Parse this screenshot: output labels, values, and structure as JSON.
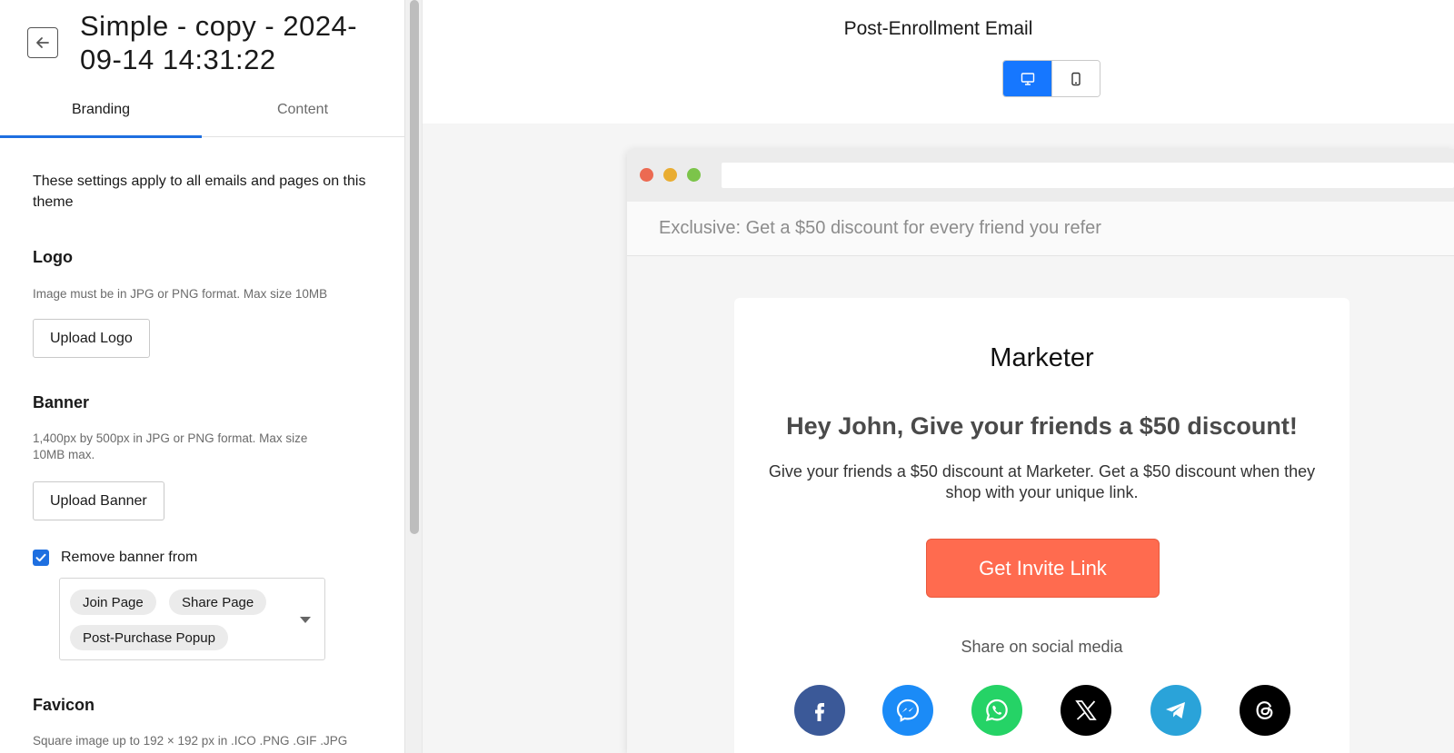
{
  "sidebar": {
    "title": "Simple - copy - 2024-09-14 14:31:22",
    "tabs": [
      {
        "label": "Branding",
        "active": true
      },
      {
        "label": "Content",
        "active": false
      }
    ],
    "intro": "These settings apply to all emails and pages on this theme",
    "logo": {
      "heading": "Logo",
      "helper": "Image must be in JPG or PNG format. Max size 10MB",
      "button": "Upload Logo"
    },
    "banner": {
      "heading": "Banner",
      "helper": "1,400px by 500px in JPG or PNG format. Max size 10MB max.",
      "button": "Upload Banner",
      "remove_label": "Remove banner from",
      "remove_checked": true,
      "selected_pages": [
        "Join Page",
        "Share Page",
        "Post-Purchase Popup"
      ]
    },
    "favicon": {
      "heading": "Favicon",
      "helper": "Square image up to 192 × 192 px in .ICO .PNG .GIF .JPG"
    }
  },
  "preview": {
    "title": "Post-Enrollment Email",
    "device_active": "desktop",
    "subject": "Exclusive: Get a $50 discount for every friend you refer",
    "email": {
      "brand": "Marketer",
      "headline": "Hey John, Give your friends a $50 discount!",
      "body": "Give your friends a $50 discount at Marketer. Get a $50 discount when they shop with your unique link.",
      "cta": "Get Invite Link",
      "share_label": "Share on social media",
      "social": [
        "facebook-icon",
        "messenger-icon",
        "whatsapp-icon",
        "x-icon",
        "telegram-icon",
        "threads-icon"
      ]
    }
  },
  "colors": {
    "accent": "#1e6fe0",
    "cta": "#ff6b4f",
    "facebook": "#3b5998",
    "messenger": "#1b8bf7",
    "whatsapp": "#25d366",
    "x": "#000000",
    "telegram": "#2aa3d9",
    "threads": "#000000"
  }
}
